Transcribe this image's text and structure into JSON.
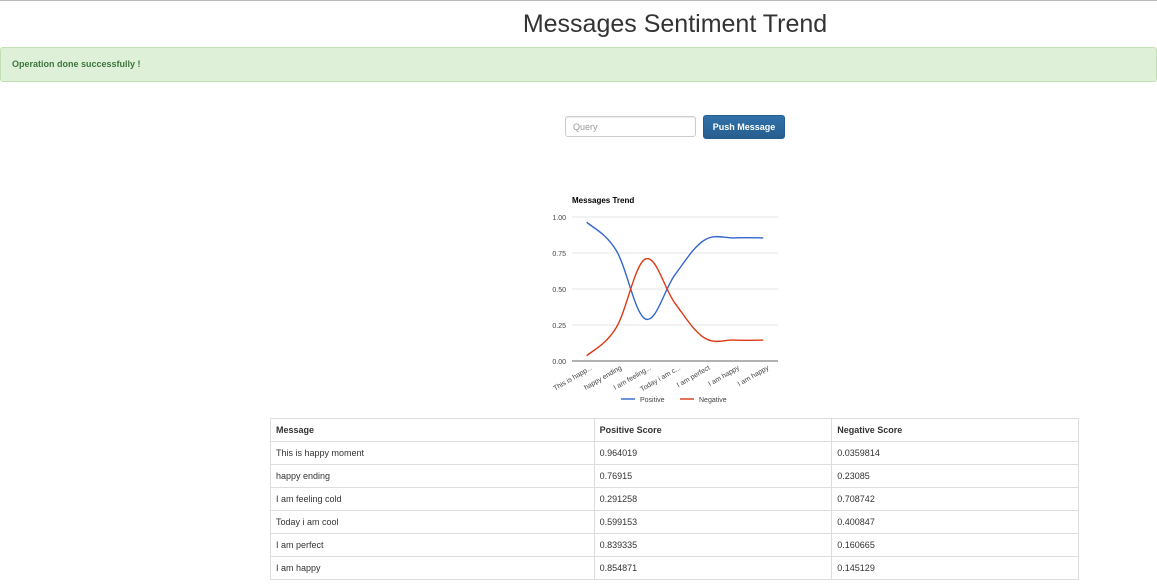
{
  "page": {
    "title": "Messages Sentiment Trend",
    "alert": "Operation done successfully !"
  },
  "form": {
    "query_placeholder": "Query",
    "query_value": "",
    "push_label": "Push Message"
  },
  "colors": {
    "positive": "#3366cc",
    "negative": "#dc3912",
    "alert_bg": "#dff0d8",
    "alert_text": "#3c763d",
    "button": "#2d6ca2"
  },
  "chart_data": {
    "type": "line",
    "title": "Messages Trend",
    "categories": [
      "This is happ...",
      "happy ending",
      "I am feeling...",
      "Today i am c...",
      "I am perfect",
      "I am happy",
      "I am happy"
    ],
    "series": [
      {
        "name": "Positive",
        "values": [
          0.964019,
          0.76915,
          0.291258,
          0.599153,
          0.839335,
          0.854871,
          0.854871
        ]
      },
      {
        "name": "Negative",
        "values": [
          0.0359814,
          0.23085,
          0.708742,
          0.400847,
          0.160665,
          0.145129,
          0.145129
        ]
      }
    ],
    "yticks": [
      "0.00",
      "0.25",
      "0.50",
      "0.75",
      "1.00"
    ],
    "ylim": [
      0,
      1
    ],
    "grid": true,
    "legend": "bottom",
    "xlabel": "",
    "ylabel": ""
  },
  "table": {
    "headers": [
      "Message",
      "Positive Score",
      "Negative Score"
    ],
    "rows": [
      [
        "This is happy moment",
        "0.964019",
        "0.0359814"
      ],
      [
        "happy ending",
        "0.76915",
        "0.23085"
      ],
      [
        "I am feeling cold",
        "0.291258",
        "0.708742"
      ],
      [
        "Today i am cool",
        "0.599153",
        "0.400847"
      ],
      [
        "I am perfect",
        "0.839335",
        "0.160665"
      ],
      [
        "I am happy",
        "0.854871",
        "0.145129"
      ]
    ]
  }
}
